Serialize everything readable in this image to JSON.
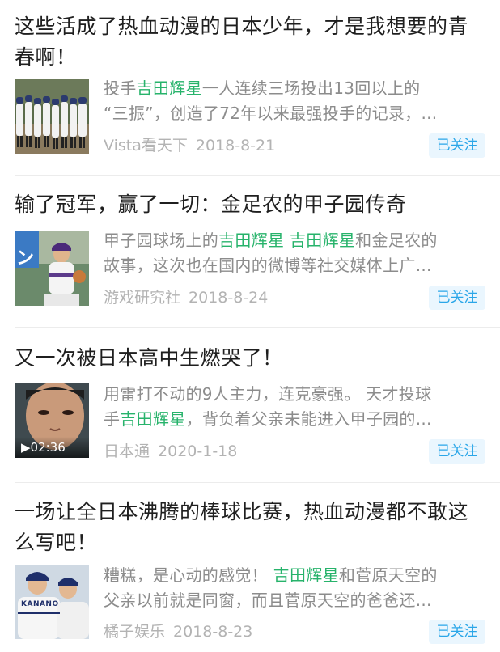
{
  "articles": [
    {
      "title_line1": "这些活成了热血动漫的日本少年，才是我想要的青",
      "title_line2": "春啊！",
      "snippet_line1": [
        {
          "text": "投手",
          "hl": false
        },
        {
          "text": "吉田辉星",
          "hl": true
        },
        {
          "text": "一人连续三场投出13回以上的",
          "hl": false
        }
      ],
      "snippet_line2": [
        {
          "text": "“三振”，创造了72年以来最强投手的记录，...",
          "hl": false
        }
      ],
      "source": "Vista看天下",
      "date": "2018-8-21",
      "follow_label": "已关注"
    },
    {
      "title_line1": "输了冠军，赢了一切：金足农的甲子园传奇",
      "title_line2": "",
      "snippet_line1": [
        {
          "text": "甲子园球场上的",
          "hl": false
        },
        {
          "text": "吉田辉星 吉田辉星",
          "hl": true
        },
        {
          "text": "和金足农的",
          "hl": false
        }
      ],
      "snippet_line2": [
        {
          "text": "故事，这次也在国内的微博等社交媒体上广...",
          "hl": false
        }
      ],
      "source": "游戏研究社",
      "date": "2018-8-24",
      "follow_label": "已关注"
    },
    {
      "title_line1": "又一次被日本高中生燃哭了！",
      "title_line2": "",
      "snippet_line1": [
        {
          "text": "用雷打不动的9人主力，连克豪强。 天才投球",
          "hl": false
        }
      ],
      "snippet_line2": [
        {
          "text": "手",
          "hl": false
        },
        {
          "text": "吉田辉星",
          "hl": true
        },
        {
          "text": "，背负着父亲未能进入甲子园的...",
          "hl": false
        }
      ],
      "source": "日本通",
      "date": "2020-1-18",
      "follow_label": "已关注",
      "video_duration": "▶02:36"
    },
    {
      "title_line1": "一场让全日本沸腾的棒球比赛，热血动漫都不敢这",
      "title_line2": "么写吧！",
      "snippet_line1": [
        {
          "text": "糟糕，是心动的感觉！ ",
          "hl": false
        },
        {
          "text": "吉田辉星",
          "hl": true
        },
        {
          "text": "和菅原天空的",
          "hl": false
        }
      ],
      "snippet_line2": [
        {
          "text": "父亲以前就是同窗，而且菅原天空的爸爸还...",
          "hl": false
        }
      ],
      "source": "橘子娱乐",
      "date": "2018-8-23",
      "follow_label": "已关注"
    }
  ],
  "thumb3_badge_text": "",
  "thumb4_jersey_text": "KANANO",
  "colors": {
    "highlight": "#27b36b",
    "follow_text": "#2aa6e8",
    "follow_bg": "#eaf6fe",
    "meta_text": "#b3b3b3",
    "snippet_text": "#8c8c8c"
  }
}
